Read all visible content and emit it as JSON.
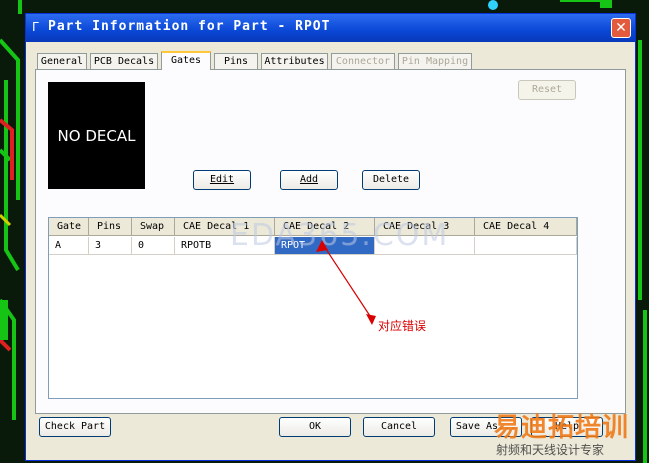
{
  "window": {
    "title": "Part Information for Part - RPOT",
    "close_label": "✕"
  },
  "tabs": [
    {
      "label": "General",
      "state": "normal"
    },
    {
      "label": "PCB Decals",
      "state": "normal"
    },
    {
      "label": "Gates",
      "state": "active"
    },
    {
      "label": "Pins",
      "state": "normal"
    },
    {
      "label": "Attributes",
      "state": "normal"
    },
    {
      "label": "Connector",
      "state": "disabled"
    },
    {
      "label": "Pin Mapping",
      "state": "disabled"
    }
  ],
  "gates_panel": {
    "preview_text": "NO DECAL",
    "reset_label": "Reset",
    "edit_label": "Edit",
    "add_label": "Add",
    "delete_label": "Delete",
    "columns": [
      "Gate",
      "Pins",
      "Swap",
      "CAE Decal 1",
      "CAE Decal 2",
      "CAE Decal 3",
      "CAE Decal 4"
    ],
    "rows": [
      [
        "A",
        "3",
        "0",
        "RPOTB",
        "RPOT",
        "",
        ""
      ]
    ],
    "selected_cell": {
      "row": 0,
      "col": 4
    }
  },
  "annotation": "对应错误",
  "watermark": "EDA365.COM",
  "footer": {
    "check_part_label": "Check Part",
    "ok_label": "OK",
    "cancel_label": "Cancel",
    "save_as_label": "Save As...",
    "help_label": "Help"
  },
  "logo": {
    "main": "易迪拓培训",
    "sub": "射频和天线设计专家"
  },
  "colors": {
    "titlebar": "#0a47d6",
    "selection": "#316ac5",
    "annotation": "#d80000",
    "dialog_bg": "#ece9d8"
  }
}
